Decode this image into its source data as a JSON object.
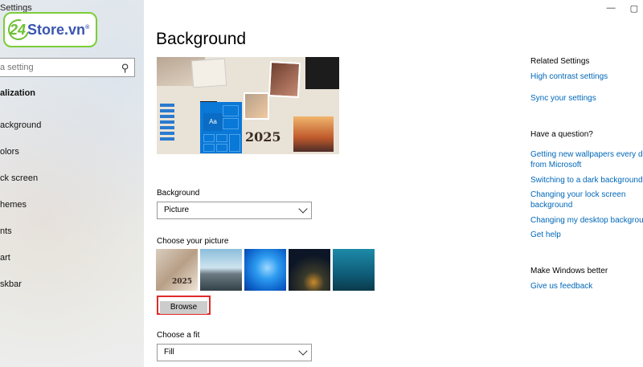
{
  "window": {
    "title": "Settings",
    "minimize_label": "—",
    "maximize_label": "▢"
  },
  "logo": {
    "number": "24",
    "text": "Store.vn",
    "reg": "®"
  },
  "sidebar": {
    "search_placeholder": "a setting",
    "heading": "alization",
    "items": [
      {
        "label": "ackground"
      },
      {
        "label": "olors"
      },
      {
        "label": "ck screen"
      },
      {
        "label": "hemes"
      },
      {
        "label": "nts"
      },
      {
        "label": "art"
      },
      {
        "label": "skbar"
      }
    ]
  },
  "main": {
    "title": "Background",
    "preview_text": "Aa",
    "preview_year": "2025",
    "background_label": "Background",
    "background_value": "Picture",
    "choose_picture_label": "Choose your picture",
    "browse_label": "Browse",
    "fit_label": "Choose a fit",
    "fit_value": "Fill"
  },
  "right": {
    "related_heading": "Related Settings",
    "related_links": [
      "High contrast settings",
      "Sync your settings"
    ],
    "question_heading": "Have a question?",
    "question_links": [
      "Getting new wallpapers every day",
      "from Microsoft",
      "Switching to a dark background t",
      "Changing your lock screen",
      "background",
      "Changing my desktop backgrour",
      "Get help"
    ],
    "better_heading": "Make Windows better",
    "feedback_link": "Give us feedback"
  },
  "colors": {
    "accent": "#0067b8",
    "highlight": "#e02a2a",
    "windows_blue": "#0a78d7"
  }
}
